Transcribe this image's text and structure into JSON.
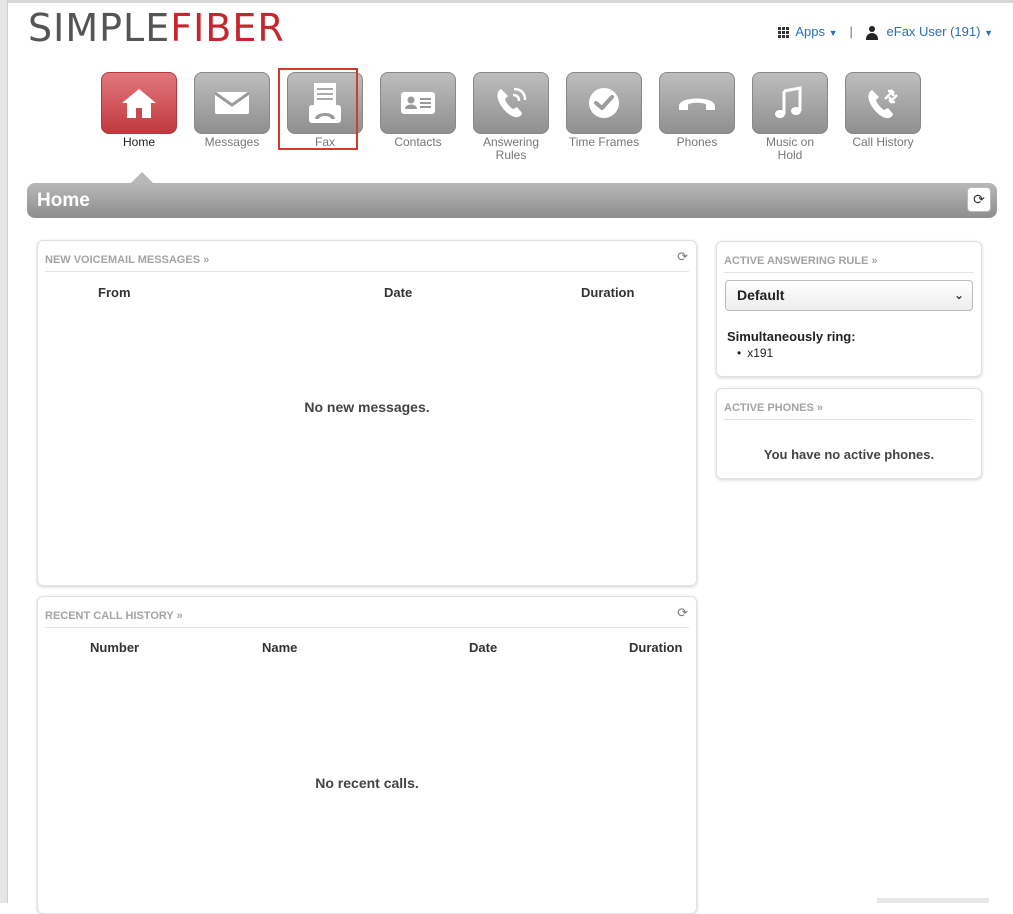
{
  "brand": {
    "part1": "SIMPLE",
    "part2": "FIBER",
    "accent": "#c8262e"
  },
  "userbar": {
    "apps_label": "Apps",
    "separator": "|",
    "user_label": "eFax User (191)"
  },
  "nav": [
    {
      "label": "Home",
      "icon": "home-icon"
    },
    {
      "label": "Messages",
      "icon": "envelope-icon"
    },
    {
      "label": "Fax",
      "icon": "fax-icon"
    },
    {
      "label": "Contacts",
      "icon": "contact-card-icon"
    },
    {
      "label": "Answering Rules",
      "icon": "phone-ringing-icon"
    },
    {
      "label": "Time Frames",
      "icon": "clock-check-icon"
    },
    {
      "label": "Phones",
      "icon": "handset-icon"
    },
    {
      "label": "Music on Hold",
      "icon": "music-note-icon"
    },
    {
      "label": "Call History",
      "icon": "phone-arrows-icon"
    }
  ],
  "page": {
    "title": "Home"
  },
  "voicemail": {
    "heading": "NEW VOICEMAIL MESSAGES »",
    "columns": [
      "From",
      "Date",
      "Duration"
    ],
    "empty_text": "No new messages."
  },
  "call_history": {
    "heading": "RECENT CALL HISTORY »",
    "columns": [
      "Number",
      "Name",
      "Date",
      "Duration"
    ],
    "empty_text": "No recent calls."
  },
  "answering_rule": {
    "heading": "ACTIVE ANSWERING RULE »",
    "selected": "Default",
    "ring_title": "Simultaneously ring:",
    "ring_items": [
      "x191"
    ]
  },
  "active_phones": {
    "heading": "ACTIVE PHONES »",
    "empty_text": "You have no active phones."
  },
  "icons": {
    "refresh": "refresh-icon"
  }
}
